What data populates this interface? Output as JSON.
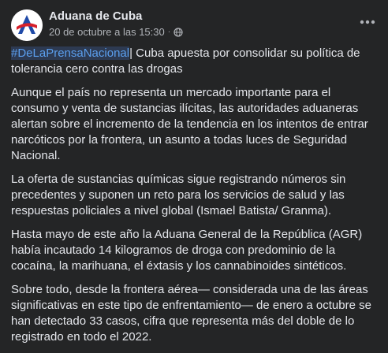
{
  "post": {
    "author": "Aduana de Cuba",
    "timestamp": "20 de octubre a las 15:30",
    "separator": "·",
    "privacy_icon": "globe-icon",
    "more_icon": "more-options-icon",
    "hashtag": "#DeLaPrensaNacional",
    "headline": "| Cuba apuesta por consolidar su política de tolerancia cero contra las drogas",
    "paragraphs": [
      "Aunque el país no representa un mercado importante para el consumo y venta de sustancias ilícitas, las autoridades aduaneras alertan sobre el incremento de la tendencia en los intentos de entrar narcóticos por la frontera, un asunto a todas luces de Seguridad Nacional.",
      "La oferta de sustancias químicas sigue registrando números sin precedentes y suponen un reto para los servicios de salud y las respuestas policiales a nivel global (Ismael Batista/ Granma).",
      "Hasta mayo de este año la Aduana General de la República (AGR) había incautado 14 kilogramos de droga con predominio de la cocaína, la marihuana, el éxtasis y los cannabinoides sintéticos.",
      "Sobre todo, desde la frontera aérea— considerada una de las áreas significativas en este tipo de enfrentamiento— de enero a octubre se han detectado 33 casos, cifra que representa más del doble de lo registrado en todo el 2022."
    ]
  },
  "colors": {
    "background": "#242526",
    "text": "#e4e6eb",
    "secondary": "#b0b3b8",
    "link": "#5b9fee",
    "logo_red": "#d6202a",
    "logo_blue": "#1f4aa8"
  }
}
